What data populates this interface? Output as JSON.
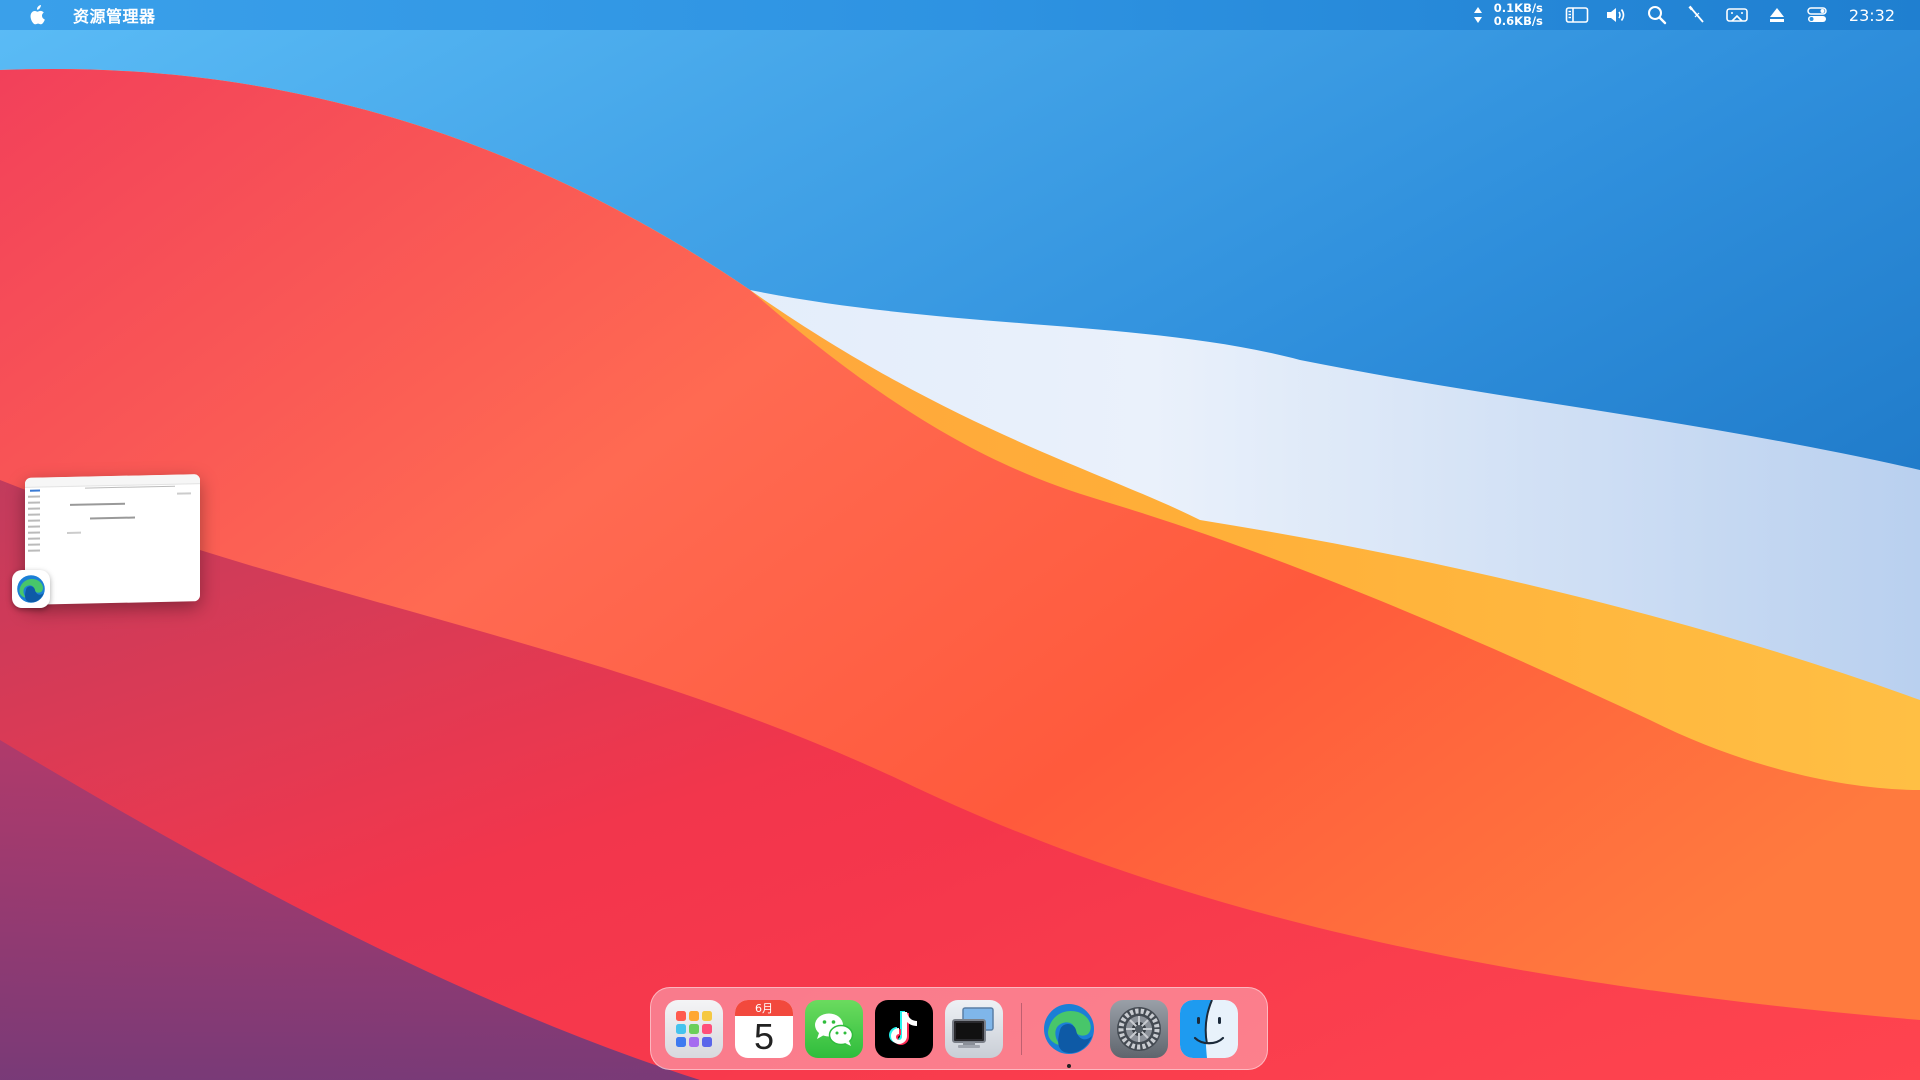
{
  "menubar": {
    "app_name": "资源管理器",
    "net_up": "0.1KB/s",
    "net_down": "0.6KB/s",
    "clock": "23:32",
    "icons": [
      "apple-logo-icon",
      "network-arrows-icon",
      "sidebar-icon",
      "volume-icon",
      "search-icon",
      "pen-icon",
      "screen-mirror-icon",
      "eject-icon",
      "control-center-icon"
    ]
  },
  "minimized_window": {
    "app_icon": "edge-icon"
  },
  "dock": {
    "calendar_month": "6月",
    "calendar_day": "5",
    "items": [
      "launchpad",
      "calendar",
      "wechat",
      "tiktok",
      "remote-desktop",
      "edge",
      "system-preferences",
      "finder"
    ],
    "running": [
      "edge",
      "finder"
    ]
  },
  "colors": {
    "menubar": "#2e93e2",
    "wallpaper_red": "#f2334a",
    "wallpaper_orange": "#ff7040",
    "wallpaper_yellow": "#ffb23a",
    "wallpaper_blue": "#1878c8"
  }
}
